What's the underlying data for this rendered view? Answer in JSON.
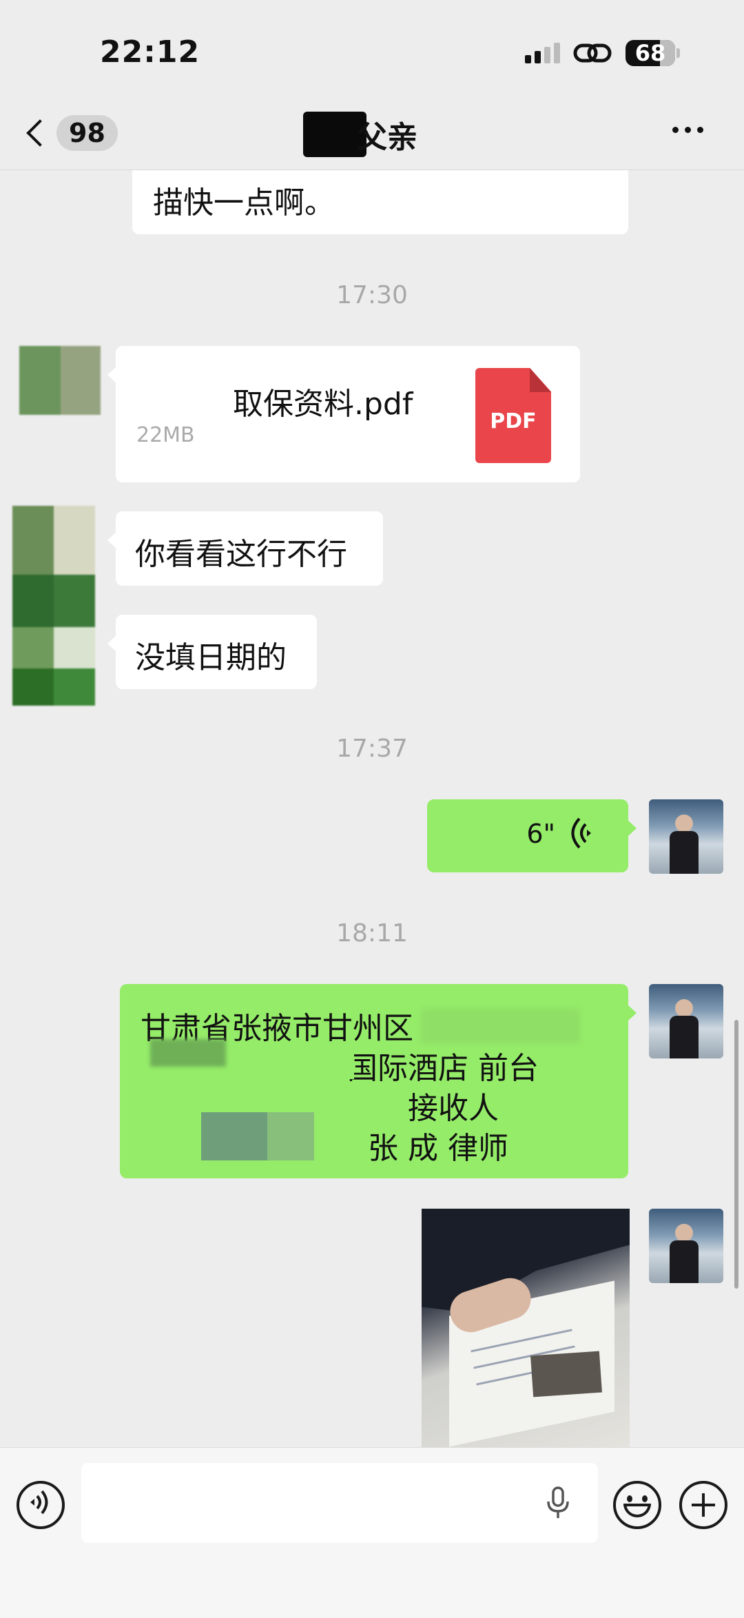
{
  "status_bar": {
    "time": "22:12",
    "battery": "68"
  },
  "nav": {
    "unread_count": "98",
    "title": "父亲"
  },
  "messages": {
    "partial_text": "描快一点啊。",
    "time_1": "17:30",
    "file": {
      "name": "取保资料.pdf",
      "size": "22MB",
      "type_label": "PDF"
    },
    "text_1": "你看看这行不行",
    "text_2": "没填日期的",
    "time_2": "17:37",
    "voice_duration": "6\"",
    "time_3": "18:11",
    "address": {
      "line1": "甘肃省张掖市甘州区",
      "line2": "国际酒店   前台",
      "line3": "接收人",
      "line4": "张    成  律师"
    }
  },
  "icons": {
    "back": "chevron-left-icon",
    "more": "more-dots-icon",
    "voice_toggle": "voice-mode-icon",
    "mic": "microphone-icon",
    "emoji": "emoji-icon",
    "plus": "plus-icon",
    "pdf": "pdf-file-icon",
    "wave": "voice-wave-icon"
  },
  "colors": {
    "bubble_green": "#95ec69",
    "bubble_white": "#ffffff",
    "background": "#ededed",
    "pdf_red": "#e9454a"
  }
}
